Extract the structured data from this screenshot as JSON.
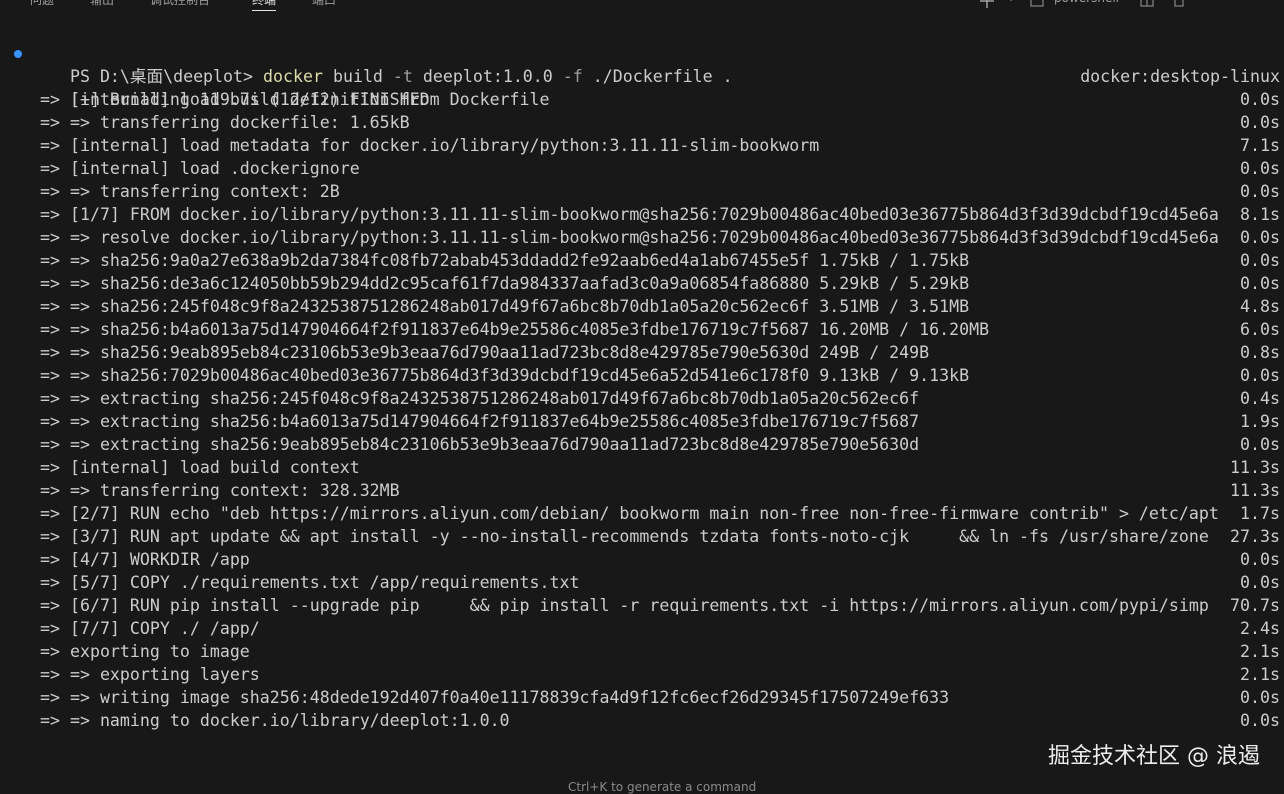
{
  "panel": {
    "tabs": [
      "问题",
      "输出",
      "调试控制台",
      "终端",
      "端口"
    ],
    "active_tab": "终端",
    "shell_label": "powershell"
  },
  "terminal": {
    "prompt": "PS D:\\桌面\\deeplot>",
    "command": {
      "program": "docker",
      "sub": "build",
      "flag1": "-t",
      "arg1": "deeplot:1.0.0",
      "flag2": "-f",
      "arg2": "./Dockerfile .",
      "status_right": "docker:desktop-linux"
    },
    "header": "[+] Building 119.7s (12/12) FINISHED",
    "steps": [
      {
        "text": "=> [internal] load build definition from Dockerfile",
        "time": "0.0s"
      },
      {
        "text": "=> => transferring dockerfile: 1.65kB",
        "time": "0.0s"
      },
      {
        "text": "=> [internal] load metadata for docker.io/library/python:3.11.11-slim-bookworm",
        "time": "7.1s"
      },
      {
        "text": "=> [internal] load .dockerignore",
        "time": "0.0s"
      },
      {
        "text": "=> => transferring context: 2B",
        "time": "0.0s"
      },
      {
        "text": "=> [1/7] FROM docker.io/library/python:3.11.11-slim-bookworm@sha256:7029b00486ac40bed03e36775b864d3f3d39dcbdf19cd45e6a",
        "time": "8.1s"
      },
      {
        "text": "=> => resolve docker.io/library/python:3.11.11-slim-bookworm@sha256:7029b00486ac40bed03e36775b864d3f3d39dcbdf19cd45e6a",
        "time": "0.0s"
      },
      {
        "text": "=> => sha256:9a0a27e638a9b2da7384fc08fb72abab453ddadd2fe92aab6ed4a1ab67455e5f 1.75kB / 1.75kB",
        "time": "0.0s"
      },
      {
        "text": "=> => sha256:de3a6c124050bb59b294dd2c95caf61f7da984337aafad3c0a9a06854fa86880 5.29kB / 5.29kB",
        "time": "0.0s"
      },
      {
        "text": "=> => sha256:245f048c9f8a2432538751286248ab017d49f67a6bc8b70db1a05a20c562ec6f 3.51MB / 3.51MB",
        "time": "4.8s"
      },
      {
        "text": "=> => sha256:b4a6013a75d147904664f2f911837e64b9e25586c4085e3fdbe176719c7f5687 16.20MB / 16.20MB",
        "time": "6.0s"
      },
      {
        "text": "=> => sha256:9eab895eb84c23106b53e9b3eaa76d790aa11ad723bc8d8e429785e790e5630d 249B / 249B",
        "time": "0.8s"
      },
      {
        "text": "=> => sha256:7029b00486ac40bed03e36775b864d3f3d39dcbdf19cd45e6a52d541e6c178f0 9.13kB / 9.13kB",
        "time": "0.0s"
      },
      {
        "text": "=> => extracting sha256:245f048c9f8a2432538751286248ab017d49f67a6bc8b70db1a05a20c562ec6f",
        "time": "0.4s"
      },
      {
        "text": "=> => extracting sha256:b4a6013a75d147904664f2f911837e64b9e25586c4085e3fdbe176719c7f5687",
        "time": "1.9s"
      },
      {
        "text": "=> => extracting sha256:9eab895eb84c23106b53e9b3eaa76d790aa11ad723bc8d8e429785e790e5630d",
        "time": "0.0s"
      },
      {
        "text": "=> [internal] load build context",
        "time": "11.3s"
      },
      {
        "text": "=> => transferring context: 328.32MB",
        "time": "11.3s"
      },
      {
        "text": "=> [2/7] RUN echo \"deb https://mirrors.aliyun.com/debian/ bookworm main non-free non-free-firmware contrib\" > /etc/apt",
        "time": "1.7s"
      },
      {
        "text": "=> [3/7] RUN apt update && apt install -y --no-install-recommends tzdata fonts-noto-cjk     && ln -fs /usr/share/zone",
        "time": "27.3s"
      },
      {
        "text": "=> [4/7] WORKDIR /app",
        "time": "0.0s"
      },
      {
        "text": "=> [5/7] COPY ./requirements.txt /app/requirements.txt",
        "time": "0.0s"
      },
      {
        "text": "=> [6/7] RUN pip install --upgrade pip     && pip install -r requirements.txt -i https://mirrors.aliyun.com/pypi/simp",
        "time": "70.7s"
      },
      {
        "text": "=> [7/7] COPY ./ /app/",
        "time": "2.4s"
      },
      {
        "text": "=> exporting to image",
        "time": "2.1s"
      },
      {
        "text": "=> => exporting layers",
        "time": "2.1s"
      },
      {
        "text": "=> => writing image sha256:48dede192d407f0a40e11178839cfa4d9f12fc6ecf26d29345f17507249ef633",
        "time": "0.0s"
      },
      {
        "text": "=> => naming to docker.io/library/deeplot:1.0.0",
        "time": "0.0s"
      }
    ],
    "input_hint": "Ctrl+K to generate a command"
  },
  "watermark": "掘金技术社区 @ 浪遏",
  "colors": {
    "background": "#181818",
    "text": "#cccccc",
    "accent_dot": "#3794ff",
    "command": "#dcdcaa"
  }
}
